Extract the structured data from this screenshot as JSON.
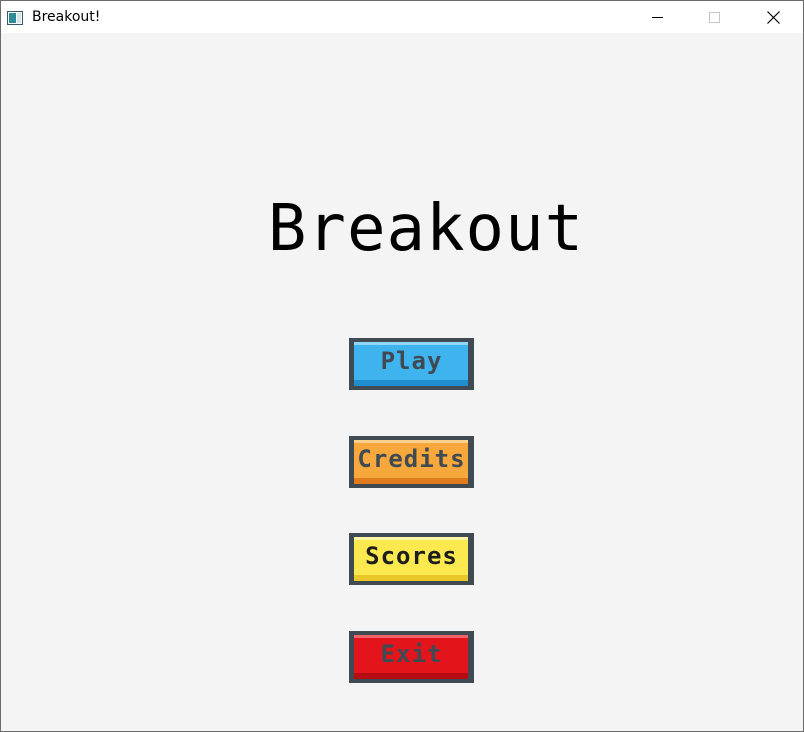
{
  "window": {
    "title": "Breakout!",
    "icons": {
      "app": "app-window-icon",
      "minimize": "minimize-icon",
      "maximize": "maximize-icon",
      "close": "close-icon"
    }
  },
  "game": {
    "title": "Breakout",
    "title_color": "#000000",
    "menu": {
      "play_label": "Play",
      "credits_label": "Credits",
      "scores_label": "Scores",
      "exit_label": "Exit"
    },
    "colors": {
      "play": "#3fb3ee",
      "credits": "#f7a83d",
      "scores": "#fbe94f",
      "exit": "#e3141b",
      "button_border": "#3f4a53",
      "background": "#f4f4f4"
    }
  }
}
